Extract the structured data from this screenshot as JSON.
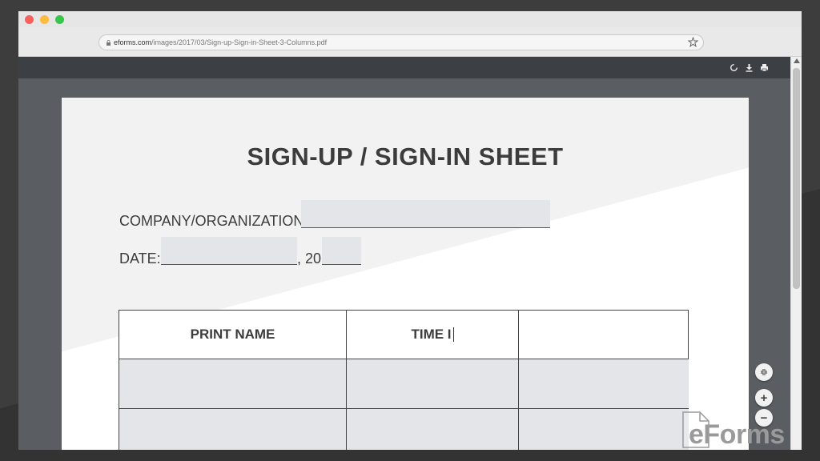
{
  "browser": {
    "url_host": "eforms.com",
    "url_path": "/images/2017/03/Sign-up-Sign-in-Sheet-3-Columns.pdf"
  },
  "toolbar": {
    "icons": [
      "rotate-icon",
      "download-icon",
      "print-icon"
    ]
  },
  "document": {
    "title": "SIGN-UP / SIGN-IN SHEET",
    "company_label": "COMPANY/ORGANIZATION:",
    "date_label": "DATE:",
    "year_prefix": ", 20",
    "table": {
      "headers": [
        "PRINT NAME",
        "TIME I",
        ""
      ]
    }
  },
  "zoom": {
    "zoom_in_label": "+",
    "zoom_out_label": "−"
  },
  "watermark": {
    "text": "eForms"
  },
  "colors": {
    "field_fill": "#e4e5e9",
    "viewer_bg": "#5a5d61",
    "toolbar_bg": "#3c3f43"
  }
}
